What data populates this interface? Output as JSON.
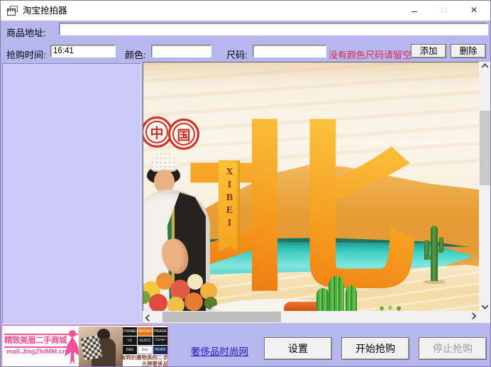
{
  "window": {
    "title": "淘宝抢拍器",
    "controls": {
      "minimize": "–",
      "maximize": "□",
      "close": "×"
    }
  },
  "form": {
    "address_label": "商品地址:",
    "address_value": "",
    "time_label": "抢购时间:",
    "time_value": "16:41",
    "color_label": "颜色:",
    "color_value": "",
    "size_label": "尺码:",
    "size_value": "",
    "hint": "没有颜色尺码请留空",
    "add_button": "添加",
    "delete_button": "删除"
  },
  "product_image": {
    "stamp_char_1": "中",
    "stamp_char_2": "国",
    "big_char": "北",
    "ribbon_text": "XIBEI"
  },
  "footer": {
    "banner": {
      "title": "精致美眉二手商城",
      "url": "mall.JingZhiMM.cn",
      "caption_line1": "淘到价廉物美的二手",
      "caption_line2": "大牌奢侈品",
      "logos": [
        "CHANEL",
        "HERMES",
        "PRADA",
        "LV",
        "GUCCI",
        "Cartier",
        "D&G",
        "Dior",
        "FENDI"
      ]
    },
    "link": "奢侈品时尚网",
    "settings_button": "设置",
    "start_button": "开始抢购",
    "stop_button": "停止抢购"
  },
  "colors": {
    "window_bg": "#b7b7f0",
    "listbox_bg": "#c9caf8",
    "hint_red": "#e02745",
    "link_blue": "#2317c9",
    "banner_pink": "#f4509a",
    "stamp_red": "#cc3126",
    "water_teal": "#3ecdc2",
    "dune_orange": "#e79d33"
  }
}
